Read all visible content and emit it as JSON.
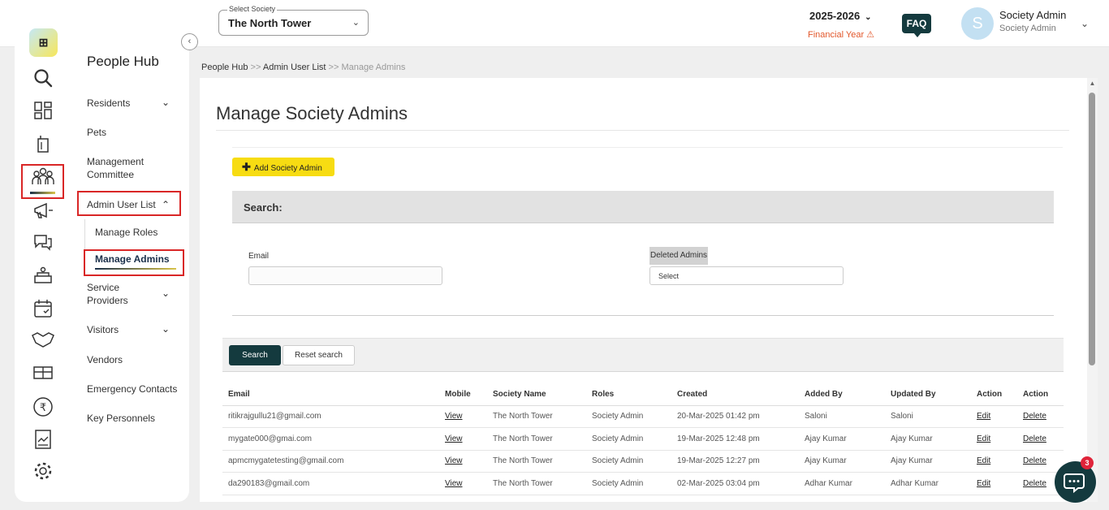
{
  "header": {
    "society_select_label": "Select Society",
    "society_name": "The North Tower",
    "year": "2025-2026",
    "financial_year_label": "Financial Year",
    "faq_label": "FAQ",
    "avatar_initial": "S",
    "user_name": "Society Admin",
    "user_role": "Society Admin"
  },
  "sidebar": {
    "title": "People Hub",
    "menu": {
      "residents": "Residents",
      "pets": "Pets",
      "management_committee_line1": "Management",
      "management_committee_line2": "Committee",
      "admin_user_list": "Admin User List",
      "manage_roles": "Manage Roles",
      "manage_admins": "Manage Admins",
      "service_providers_line1": "Service",
      "service_providers_line2": "Providers",
      "visitors": "Visitors",
      "vendors": "Vendors",
      "emergency_contacts": "Emergency Contacts",
      "key_personnels": "Key Personnels"
    }
  },
  "breadcrumb": {
    "part1": "People Hub",
    "sep1": " >> ",
    "part2": "Admin User List",
    "sep2": " >> ",
    "part3": "Manage Admins"
  },
  "main": {
    "page_title": "Manage Society Admins",
    "add_button": "Add Society Admin",
    "search_heading": "Search:",
    "email_label": "Email",
    "email_value": "",
    "deleted_label": "Deleted Admins",
    "deleted_selected": "Select",
    "search_button": "Search",
    "reset_button": "Reset search"
  },
  "table": {
    "headers": [
      "Email",
      "Mobile",
      "Society Name",
      "Roles",
      "Created",
      "Added By",
      "Updated By",
      "Action",
      "Action"
    ],
    "rows": [
      {
        "email": "ritikrajgullu21@gmail.com",
        "mobile": "View",
        "society": "The North Tower",
        "role": "Society Admin",
        "created": "20-Mar-2025 01:42 pm",
        "added_by": "Saloni",
        "updated_by": "Saloni",
        "edit": "Edit",
        "delete": "Delete"
      },
      {
        "email": "mygate000@gmai.com",
        "mobile": "View",
        "society": "The North Tower",
        "role": "Society Admin",
        "created": "19-Mar-2025 12:48 pm",
        "added_by": "Ajay Kumar",
        "updated_by": "Ajay Kumar",
        "edit": "Edit",
        "delete": "Delete"
      },
      {
        "email": "apmcmygatetesting@gmail.com",
        "mobile": "View",
        "society": "The North Tower",
        "role": "Society Admin",
        "created": "19-Mar-2025 12:27 pm",
        "added_by": "Ajay Kumar",
        "updated_by": "Ajay Kumar",
        "edit": "Edit",
        "delete": "Delete"
      },
      {
        "email": "da290183@gmail.com",
        "mobile": "View",
        "society": "The North Tower",
        "role": "Society Admin",
        "created": "02-Mar-2025 03:04 pm",
        "added_by": "Adhar Kumar",
        "updated_by": "Adhar Kumar",
        "edit": "Edit",
        "delete": "Delete"
      }
    ]
  },
  "chat": {
    "badge_count": "3"
  },
  "icons": {
    "logo": "app-logo-icon",
    "rail": [
      "search-icon",
      "dashboard-icon",
      "building-icon",
      "people-icon",
      "megaphone-icon",
      "chat-icon",
      "amenities-icon",
      "calendar-icon",
      "handshake-icon",
      "gift-icon",
      "rupee-icon",
      "report-icon",
      "settings-icon"
    ]
  },
  "colors": {
    "accent_yellow": "#f7dc12",
    "dark_teal": "#143a3e",
    "highlight_red": "#d92626",
    "warning_orange": "#e2572b"
  }
}
